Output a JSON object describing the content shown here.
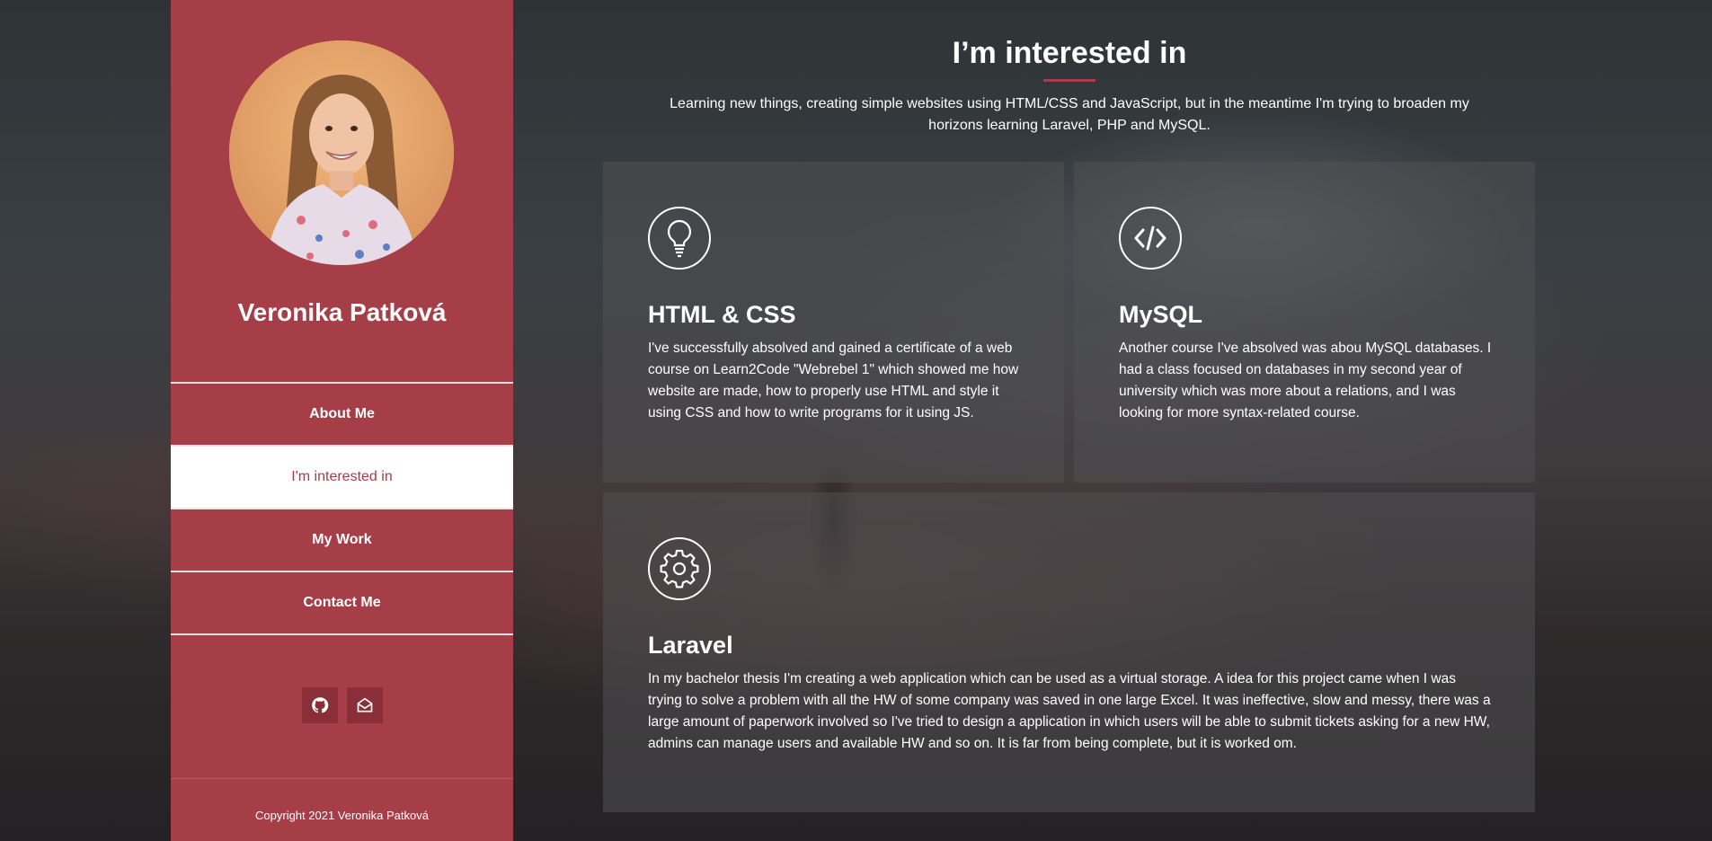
{
  "profile": {
    "name": "Veronika Patková"
  },
  "nav": {
    "items": [
      {
        "label": "About Me",
        "active": false
      },
      {
        "label": "I'm interested in",
        "active": true
      },
      {
        "label": "My Work",
        "active": false
      },
      {
        "label": "Contact Me",
        "active": false
      }
    ]
  },
  "social": {
    "icons": [
      "github-icon",
      "envelope-open-icon"
    ]
  },
  "footer": {
    "copyright": "Copyright 2021 Veronika Patková"
  },
  "main": {
    "title": "I’m interested in",
    "intro": "Learning new things, creating simple websites using HTML/CSS and JavaScript, but in the meantime I'm trying to broaden my horizons learning Laravel, PHP and MySQL.",
    "cards": [
      {
        "icon": "lightbulb-icon",
        "title": "HTML & CSS",
        "text": "I've successfully absolved and gained a certificate of a web course on Learn2Code \"Webrebel 1\" which showed me how website are made, how to properly use HTML and style it using CSS and how to write programs for it using JS."
      },
      {
        "icon": "code-icon",
        "title": "MySQL",
        "text": "Another course I've absolved was abou MySQL databases. I had a class focused on databases in my second year of university which was more about a relations, and I was looking for more syntax-related course."
      },
      {
        "icon": "gear-icon",
        "title": "Laravel",
        "text": "In my bachelor thesis I'm creating a web application which can be used as a virtual storage. A idea for this project came when I was trying to solve a problem with all the HW of some company was saved in one large Excel. It was ineffective, slow and messy, there was a large amount of paperwork involved so I've tried to design a application in which users will be able to submit tickets asking for a new HW, admins can manage users and available HW and so on. It is far from being complete, but it is worked om."
      }
    ]
  },
  "colors": {
    "accent": "#a63e48",
    "social_button": "#8a2f38",
    "text": "#ffffff"
  }
}
